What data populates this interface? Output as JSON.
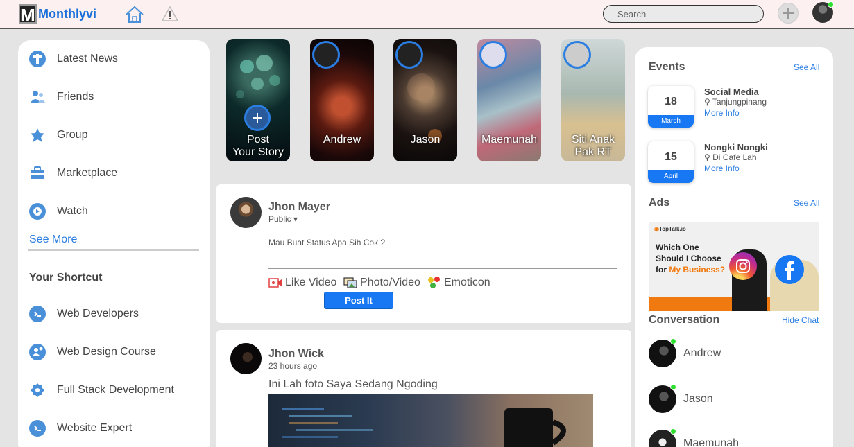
{
  "header": {
    "logo_letter": "M",
    "logo_text": "Monthlyvi",
    "search_placeholder": "Search"
  },
  "sidebar": {
    "items": [
      {
        "label": "Latest News"
      },
      {
        "label": "Friends"
      },
      {
        "label": "Group"
      },
      {
        "label": "Marketplace"
      },
      {
        "label": "Watch"
      }
    ],
    "see_more": "See More",
    "shortcut_title": "Your Shortcut",
    "shortcuts": [
      {
        "label": "Web Developers"
      },
      {
        "label": "Web Design Course"
      },
      {
        "label": "Full Stack Development"
      },
      {
        "label": "Website Expert"
      }
    ]
  },
  "stories": [
    {
      "line1": "Post",
      "line2": "Your Story"
    },
    {
      "line1": "Andrew",
      "line2": ""
    },
    {
      "line1": "Jason",
      "line2": ""
    },
    {
      "line1": "Maemunah",
      "line2": ""
    },
    {
      "line1": "Siti Anak",
      "line2": "Pak RT"
    }
  ],
  "composer": {
    "name": "Jhon Mayer",
    "privacy": "Public",
    "placeholder": "Mau Buat Status Apa Sih Cok ?",
    "actions": {
      "video": "Like Video",
      "photo": "Photo/Video",
      "emoticon": "Emoticon"
    },
    "post_button": "Post It"
  },
  "post": {
    "name": "Jhon Wick",
    "time": "23 hours ago",
    "text": "Ini Lah foto Saya Sedang Ngoding"
  },
  "events": {
    "title": "Events",
    "see_all": "See All",
    "items": [
      {
        "day": "18",
        "month": "March",
        "title": "Social Media",
        "location": "Tanjungpinang",
        "more": "More Info"
      },
      {
        "day": "15",
        "month": "April",
        "title": "Nongki Nongki",
        "location": "Di Cafe Lah",
        "more": "More Info"
      }
    ]
  },
  "ads": {
    "title": "Ads",
    "see_all": "See All",
    "brand": "TopTalk.io",
    "headline_1": "Which One",
    "headline_2": "Should I Choose",
    "headline_3_a": "for ",
    "headline_3_b": "My Business?"
  },
  "conversation": {
    "title": "Conversation",
    "hide": "Hide Chat",
    "people": [
      {
        "name": "Andrew"
      },
      {
        "name": "Jason"
      },
      {
        "name": "Maemunah"
      }
    ]
  },
  "colors": {
    "accent": "#1877f2",
    "online": "#2ee02e"
  }
}
